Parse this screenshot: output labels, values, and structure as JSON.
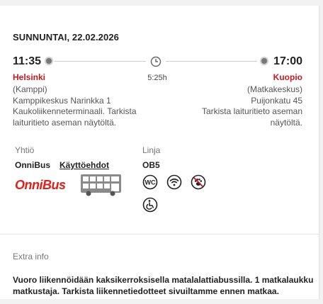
{
  "trip": {
    "date": "SUNNUNTAI, 22.02.2026",
    "departure": {
      "time": "11:35",
      "city": "Helsinki",
      "station": "(Kamppi)",
      "address_lines": [
        "Kamppikeskus Narinkka 1",
        "Kaukoliikenneterminaali. Tarkista",
        "laituritieto aseman näytöltä."
      ]
    },
    "duration": "5:25h",
    "arrival": {
      "time": "17:00",
      "city": "Kuopio",
      "station": "(Matkakeskus)",
      "address_lines": [
        "Puijonkatu 45",
        "Tarkista laituritieto aseman",
        "näytöltä."
      ]
    }
  },
  "company": {
    "label": "Yhtiö",
    "name": "OnniBus",
    "terms_link": "Käyttöehdot",
    "logo_text": "OnniBus"
  },
  "line": {
    "label": "Linja",
    "code": "OB5",
    "amenities": [
      "wc-icon",
      "wifi-icon",
      "no-pets-icon",
      "wheelchair-icon"
    ]
  },
  "extra_info": {
    "title": "Extra info",
    "lines": [
      "Vuoro liikennöidään kaksikerroksisella matalalattiabussilla. 1 matkalaukku",
      "matkustaja. Tarkista liikennetiedotteet sivuiltamme ennen matkaa."
    ]
  },
  "colors": {
    "accent": "#c8191e",
    "logo": "#e0201c",
    "muted": "#777777"
  }
}
